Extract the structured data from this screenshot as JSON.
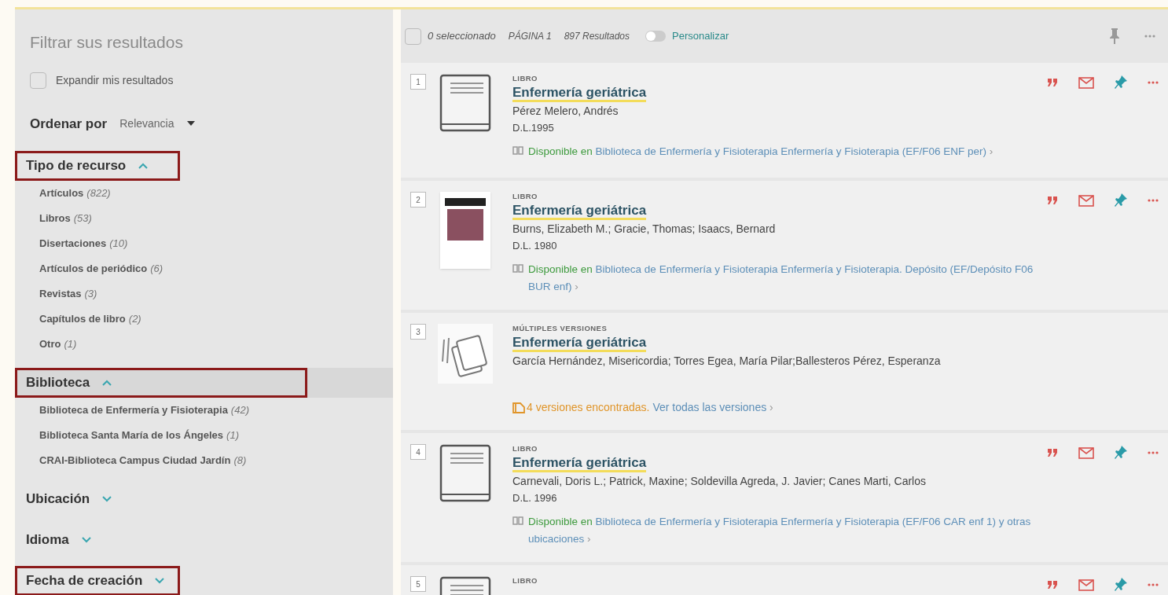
{
  "sidebar": {
    "title": "Filtrar sus resultados",
    "expand_checkbox": {
      "label": "Expandir mis resultados",
      "checked": false
    },
    "sort": {
      "label": "Ordenar por",
      "value": "Relevancia"
    },
    "facets": [
      {
        "title": "Tipo de recurso",
        "expanded": true,
        "highlighted": true,
        "items": [
          {
            "name": "Artículos",
            "count": "(822)"
          },
          {
            "name": "Libros",
            "count": "(53)"
          },
          {
            "name": "Disertaciones",
            "count": "(10)"
          },
          {
            "name": "Artículos de periódico",
            "count": "(6)"
          },
          {
            "name": "Revistas",
            "count": "(3)"
          },
          {
            "name": "Capítulos de libro",
            "count": "(2)"
          },
          {
            "name": "Otro",
            "count": "(1)"
          }
        ]
      },
      {
        "title": "Biblioteca",
        "expanded": true,
        "highlighted": true,
        "items": [
          {
            "name": "Biblioteca de Enfermería y Fisioterapia",
            "count": "(42)"
          },
          {
            "name": "Biblioteca Santa María de los Ángeles",
            "count": "(1)"
          },
          {
            "name": "CRAI-Biblioteca Campus Ciudad Jardín",
            "count": "(8)"
          }
        ]
      },
      {
        "title": "Ubicación",
        "expanded": false,
        "highlighted": false
      },
      {
        "title": "Idioma",
        "expanded": false,
        "highlighted": false
      },
      {
        "title": "Fecha de creación",
        "expanded": false,
        "highlighted": true
      }
    ]
  },
  "results_header": {
    "select_all_checked": false,
    "selected": "0 seleccionado",
    "page": "PÁGINA 1",
    "count": "897 Resultados",
    "personalize": {
      "label": "Personalizar",
      "on": false
    }
  },
  "results": [
    {
      "number": "1",
      "kind": "book",
      "type": "LIBRO",
      "title": "Enfermería geriátrica",
      "authors": "Pérez Melero, Andrés",
      "date": "D.L.1995",
      "availability": {
        "status": "Disponible en",
        "location": "Biblioteca de Enfermería y Fisioterapia  Enfermería y Fisioterapia (EF/F06 ENF per)",
        "arrow": "›"
      },
      "actions": true
    },
    {
      "number": "2",
      "kind": "cover",
      "type": "LIBRO",
      "title": "Enfermería geriátrica",
      "authors": "Burns, Elizabeth M.; Gracie, Thomas; Isaacs, Bernard",
      "date": "D.L. 1980",
      "availability": {
        "status": "Disponible en",
        "location": "Biblioteca de Enfermería y Fisioterapia  Enfermería y Fisioterapia. Depósito (EF/Depósito F06 BUR enf)",
        "arrow": "›"
      },
      "actions": true
    },
    {
      "number": "3",
      "kind": "versions",
      "type": "MÚLTIPLES VERSIONES",
      "title": "Enfermería geriátrica",
      "authors": "García Hernández, Misericordia; Torres Egea, María Pilar;Ballesteros Pérez, Esperanza",
      "versions": {
        "found": "4 versiones encontradas.",
        "link": "Ver todas las versiones",
        "arrow": "›"
      },
      "actions": false
    },
    {
      "number": "4",
      "kind": "book",
      "type": "LIBRO",
      "title": "Enfermería geriátrica",
      "authors": "Carnevali, Doris L.; Patrick, Maxine; Soldevilla Agreda, J. Javier; Canes Marti, Carlos",
      "date": "D.L. 1996",
      "availability": {
        "status": "Disponible en",
        "location": "Biblioteca de Enfermería y Fisioterapia  Enfermería y Fisioterapia (EF/F06 CAR enf 1) y otras ubicaciones",
        "arrow": "›"
      },
      "actions": true
    },
    {
      "number": "5",
      "kind": "book",
      "type": "LIBRO",
      "actions": true
    }
  ]
}
